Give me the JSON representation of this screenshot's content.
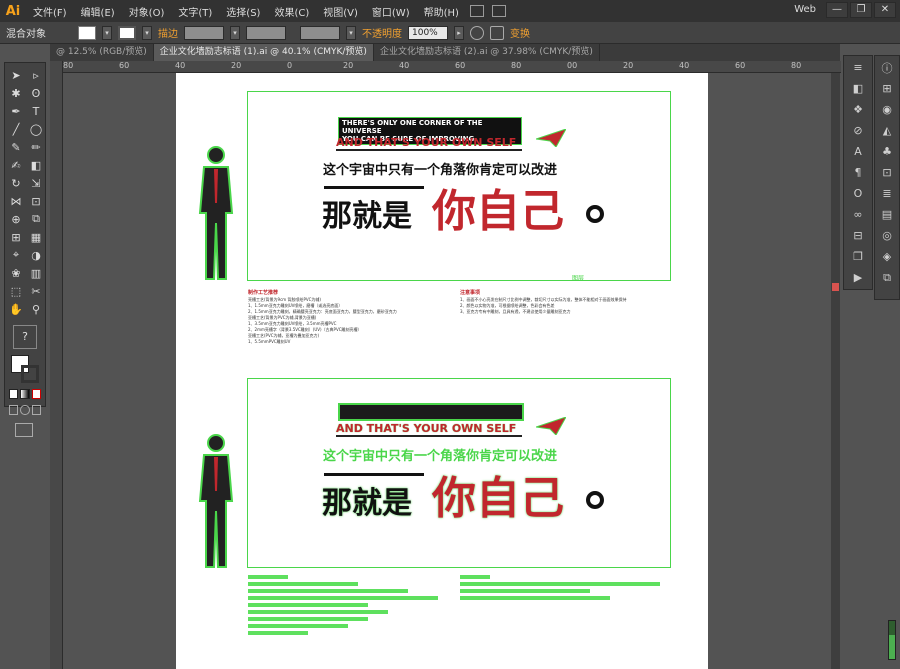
{
  "app": {
    "logo": "Ai",
    "menu": [
      "文件(F)",
      "编辑(E)",
      "对象(O)",
      "文字(T)",
      "选择(S)",
      "效果(C)",
      "视图(V)",
      "窗口(W)",
      "帮助(H)"
    ],
    "workspace": "Web",
    "window_buttons": [
      "—",
      "❐",
      "✕"
    ]
  },
  "control_bar": {
    "object_label": "混合对象",
    "stroke_label": "描边",
    "opacity_label": "不透明度",
    "opacity_value": "100%",
    "transform_label": "变换"
  },
  "tabs": [
    {
      "label": "@ 12.5% (RGB/预览)",
      "active": false
    },
    {
      "label": "企业文化墙励志标语 (1).ai @ 40.1% (CMYK/预览)",
      "active": true
    },
    {
      "label": "企业文化墙励志标语 (2).ai @ 37.98% (CMYK/预览)",
      "active": false
    }
  ],
  "ruler": {
    "h_ticks": [
      "80",
      "60",
      "40",
      "20",
      "0",
      "20",
      "40",
      "60",
      "80",
      "00",
      "20",
      "40",
      "60",
      "80"
    ],
    "v_ticks": [
      "1",
      "5",
      "0",
      "5",
      "0",
      "5",
      "0",
      "5",
      "0",
      "5",
      "0",
      "5"
    ]
  },
  "tools": [
    "selection-tool",
    "direct-selection-tool",
    "magic-wand-tool",
    "lasso-tool",
    "pen-tool",
    "type-tool",
    "line-tool",
    "ellipse-tool",
    "paintbrush-tool",
    "pencil-tool",
    "blob-brush-tool",
    "eraser-tool",
    "rotate-tool",
    "scale-tool",
    "width-tool",
    "free-transform-tool",
    "shape-builder-tool",
    "perspective-tool",
    "mesh-tool",
    "gradient-tool",
    "eyedropper-tool",
    "blend-tool",
    "symbol-sprayer-tool",
    "column-graph-tool",
    "artboard-tool",
    "slice-tool",
    "hand-tool",
    "zoom-tool"
  ],
  "artwork": {
    "top": {
      "line1": "THERE'S ONLY ONE CORNER OF THE UNIVERSE",
      "line2": "YOU CAN BE SURE OF IMPROVING",
      "line3": "AND THAT'S YOUR OWN SELF",
      "line4": "这个宇宙中只有一个角落你肯定可以改进",
      "line5a": "那就是",
      "line5b": "你自己",
      "label": "图层"
    },
    "bottom": {
      "line3": "AND THAT'S YOUR OWN SELF",
      "line4": "这个宇宙中只有一个角落你肯定可以改进",
      "line5a": "那就是",
      "line5b": "你自己"
    },
    "process_title": "制作工艺推荐",
    "notes_title": "注意事项",
    "process_items": [
      "亮槽工艺(背景为9cm 背胶喷绘PVC为辅)",
      "1、1.5mm亚克力雕刻UV喷绘，磨槽（或选亮底面）",
      "2、1.5mm亚克力雕刻，精确腰亮亚克力：亮底面亚克力，腰型亚克力，磨砂亚克力",
      "亚槽工艺(背景为PVC为辅,背景为亚槽)",
      "1、3.5mm亚克力雕刻UV喷绘，3.5mm亮槽PVC",
      "2、2mm亮槽字（背景3.5VC雕刻）(UV)（古典PVC雕刻亮槽）",
      "亚槽工艺(PVC为辅，亚槽为叠加亚克力)",
      "1、5.5mmPVC雕刻UV"
    ],
    "note_items": [
      "1、画面不小心亮发在制尺寸比例中调整，裁切尺寸以实际为准，整体不能相对于画面效果保持",
      "2、颜色以实物为准，可根据喷绘调整，色彩会有色差",
      "3、亚克力专有中雕刻，且具有透，不建议使用少量雕刻亚克力"
    ]
  }
}
